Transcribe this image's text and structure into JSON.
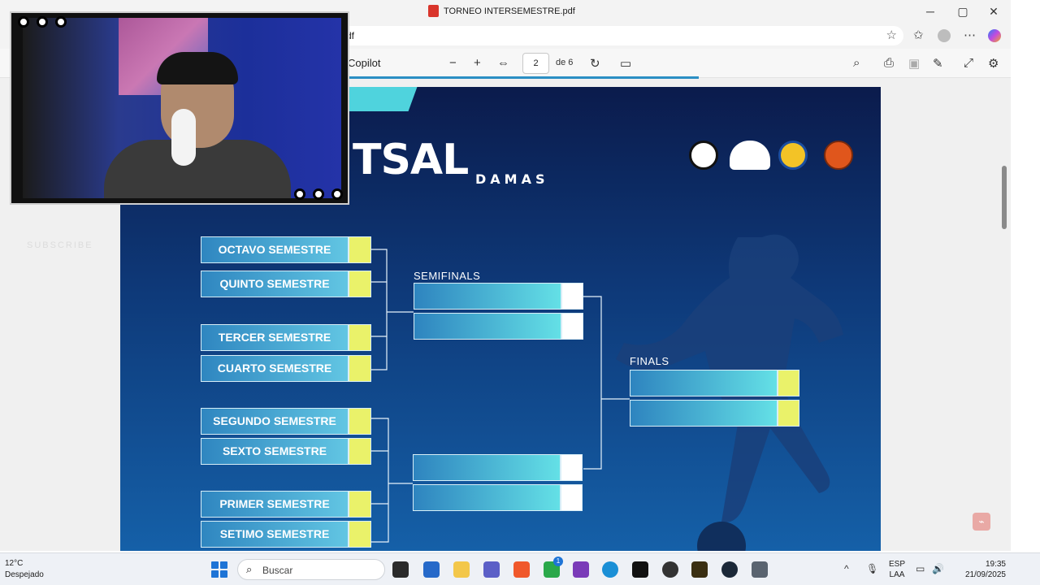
{
  "window": {
    "title": "TORNEO INTERSEMESTRE.pdf",
    "minimize": "─",
    "maximize": "▢",
    "close": "✕"
  },
  "addressbar": {
    "url_fragment": "df"
  },
  "pdf_toolbar": {
    "copilot_label": "Copilot",
    "zoom_out": "−",
    "zoom_in": "+",
    "current_page": "2",
    "page_total": "de 6"
  },
  "bracket": {
    "headline": "TSAL",
    "subhead": "DAMAS",
    "semifinals_label": "SEMIFINALS",
    "finals_label": "FINALS",
    "teams": [
      "OCTAVO SEMESTRE",
      "QUINTO SEMESTRE",
      "TERCER SEMESTRE",
      "CUARTO SEMESTRE",
      "SEGUNDO SEMESTRE",
      "SEXTO SEMESTRE",
      "PRIMER SEMESTRE",
      "SETIMO SEMESTRE"
    ]
  },
  "overlay": {
    "subscribe": "SUBSCRIBE"
  },
  "taskbar": {
    "weather_temp": "12°C",
    "weather_desc": "Despejado",
    "search_placeholder": "Buscar",
    "lang_top": "ESP",
    "lang_bottom": "LAA",
    "time": "19:35",
    "date": "21/09/2025",
    "notification_count": "1"
  },
  "colors": {
    "accent_cyan": "#4fd3dd",
    "score_yellow": "#eaf26a",
    "page_bg_dark": "#0b1b4c"
  }
}
